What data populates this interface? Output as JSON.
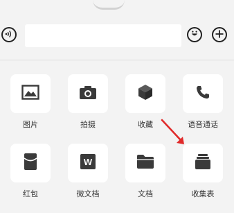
{
  "composer": {
    "text_value": "",
    "voice_icon": "voice-icon",
    "emoji_icon": "emoji-icon",
    "plus_icon": "plus-icon"
  },
  "tools": {
    "items": [
      {
        "label": "图片",
        "icon": "image-icon"
      },
      {
        "label": "拍摄",
        "icon": "camera-icon"
      },
      {
        "label": "收藏",
        "icon": "cube-icon"
      },
      {
        "label": "语音通话",
        "icon": "phone-icon"
      },
      {
        "label": "红包",
        "icon": "red-envelope-icon"
      },
      {
        "label": "微文档",
        "icon": "word-doc-icon",
        "glyph": "W"
      },
      {
        "label": "文档",
        "icon": "folder-icon"
      },
      {
        "label": "收集表",
        "icon": "collection-form-icon"
      }
    ]
  },
  "colors": {
    "background": "#f3f3f3",
    "tile": "#ffffff",
    "icon": "#3a3a3a",
    "annotation_arrow": "#e02a2a"
  }
}
